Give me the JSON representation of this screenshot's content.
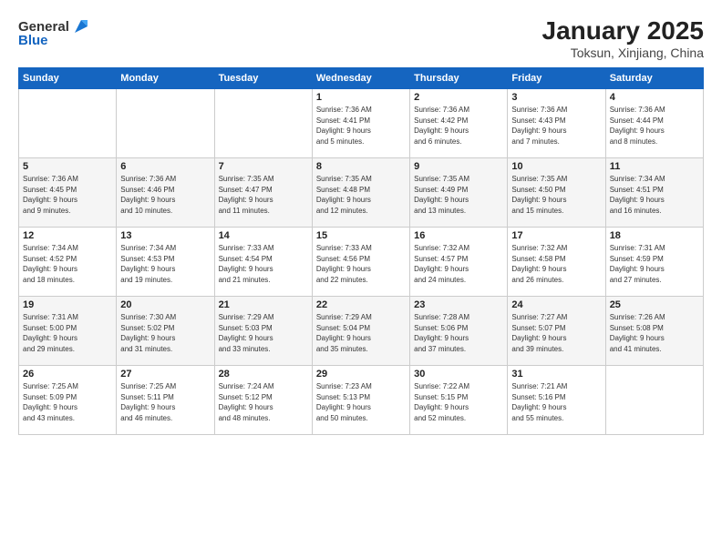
{
  "logo": {
    "general": "General",
    "blue": "Blue"
  },
  "title": "January 2025",
  "location": "Toksun, Xinjiang, China",
  "weekdays": [
    "Sunday",
    "Monday",
    "Tuesday",
    "Wednesday",
    "Thursday",
    "Friday",
    "Saturday"
  ],
  "weeks": [
    [
      {
        "day": "",
        "info": ""
      },
      {
        "day": "",
        "info": ""
      },
      {
        "day": "",
        "info": ""
      },
      {
        "day": "1",
        "info": "Sunrise: 7:36 AM\nSunset: 4:41 PM\nDaylight: 9 hours\nand 5 minutes."
      },
      {
        "day": "2",
        "info": "Sunrise: 7:36 AM\nSunset: 4:42 PM\nDaylight: 9 hours\nand 6 minutes."
      },
      {
        "day": "3",
        "info": "Sunrise: 7:36 AM\nSunset: 4:43 PM\nDaylight: 9 hours\nand 7 minutes."
      },
      {
        "day": "4",
        "info": "Sunrise: 7:36 AM\nSunset: 4:44 PM\nDaylight: 9 hours\nand 8 minutes."
      }
    ],
    [
      {
        "day": "5",
        "info": "Sunrise: 7:36 AM\nSunset: 4:45 PM\nDaylight: 9 hours\nand 9 minutes."
      },
      {
        "day": "6",
        "info": "Sunrise: 7:36 AM\nSunset: 4:46 PM\nDaylight: 9 hours\nand 10 minutes."
      },
      {
        "day": "7",
        "info": "Sunrise: 7:35 AM\nSunset: 4:47 PM\nDaylight: 9 hours\nand 11 minutes."
      },
      {
        "day": "8",
        "info": "Sunrise: 7:35 AM\nSunset: 4:48 PM\nDaylight: 9 hours\nand 12 minutes."
      },
      {
        "day": "9",
        "info": "Sunrise: 7:35 AM\nSunset: 4:49 PM\nDaylight: 9 hours\nand 13 minutes."
      },
      {
        "day": "10",
        "info": "Sunrise: 7:35 AM\nSunset: 4:50 PM\nDaylight: 9 hours\nand 15 minutes."
      },
      {
        "day": "11",
        "info": "Sunrise: 7:34 AM\nSunset: 4:51 PM\nDaylight: 9 hours\nand 16 minutes."
      }
    ],
    [
      {
        "day": "12",
        "info": "Sunrise: 7:34 AM\nSunset: 4:52 PM\nDaylight: 9 hours\nand 18 minutes."
      },
      {
        "day": "13",
        "info": "Sunrise: 7:34 AM\nSunset: 4:53 PM\nDaylight: 9 hours\nand 19 minutes."
      },
      {
        "day": "14",
        "info": "Sunrise: 7:33 AM\nSunset: 4:54 PM\nDaylight: 9 hours\nand 21 minutes."
      },
      {
        "day": "15",
        "info": "Sunrise: 7:33 AM\nSunset: 4:56 PM\nDaylight: 9 hours\nand 22 minutes."
      },
      {
        "day": "16",
        "info": "Sunrise: 7:32 AM\nSunset: 4:57 PM\nDaylight: 9 hours\nand 24 minutes."
      },
      {
        "day": "17",
        "info": "Sunrise: 7:32 AM\nSunset: 4:58 PM\nDaylight: 9 hours\nand 26 minutes."
      },
      {
        "day": "18",
        "info": "Sunrise: 7:31 AM\nSunset: 4:59 PM\nDaylight: 9 hours\nand 27 minutes."
      }
    ],
    [
      {
        "day": "19",
        "info": "Sunrise: 7:31 AM\nSunset: 5:00 PM\nDaylight: 9 hours\nand 29 minutes."
      },
      {
        "day": "20",
        "info": "Sunrise: 7:30 AM\nSunset: 5:02 PM\nDaylight: 9 hours\nand 31 minutes."
      },
      {
        "day": "21",
        "info": "Sunrise: 7:29 AM\nSunset: 5:03 PM\nDaylight: 9 hours\nand 33 minutes."
      },
      {
        "day": "22",
        "info": "Sunrise: 7:29 AM\nSunset: 5:04 PM\nDaylight: 9 hours\nand 35 minutes."
      },
      {
        "day": "23",
        "info": "Sunrise: 7:28 AM\nSunset: 5:06 PM\nDaylight: 9 hours\nand 37 minutes."
      },
      {
        "day": "24",
        "info": "Sunrise: 7:27 AM\nSunset: 5:07 PM\nDaylight: 9 hours\nand 39 minutes."
      },
      {
        "day": "25",
        "info": "Sunrise: 7:26 AM\nSunset: 5:08 PM\nDaylight: 9 hours\nand 41 minutes."
      }
    ],
    [
      {
        "day": "26",
        "info": "Sunrise: 7:25 AM\nSunset: 5:09 PM\nDaylight: 9 hours\nand 43 minutes."
      },
      {
        "day": "27",
        "info": "Sunrise: 7:25 AM\nSunset: 5:11 PM\nDaylight: 9 hours\nand 46 minutes."
      },
      {
        "day": "28",
        "info": "Sunrise: 7:24 AM\nSunset: 5:12 PM\nDaylight: 9 hours\nand 48 minutes."
      },
      {
        "day": "29",
        "info": "Sunrise: 7:23 AM\nSunset: 5:13 PM\nDaylight: 9 hours\nand 50 minutes."
      },
      {
        "day": "30",
        "info": "Sunrise: 7:22 AM\nSunset: 5:15 PM\nDaylight: 9 hours\nand 52 minutes."
      },
      {
        "day": "31",
        "info": "Sunrise: 7:21 AM\nSunset: 5:16 PM\nDaylight: 9 hours\nand 55 minutes."
      },
      {
        "day": "",
        "info": ""
      }
    ]
  ]
}
